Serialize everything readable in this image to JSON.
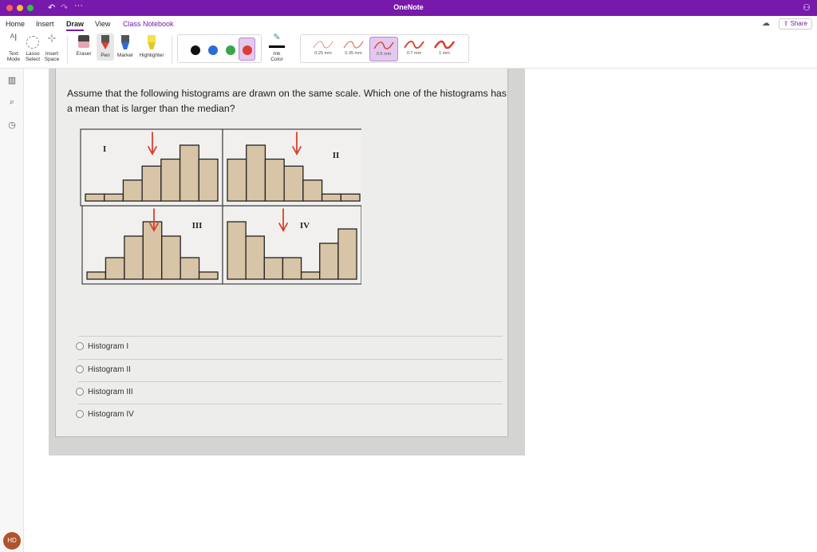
{
  "window": {
    "title": "OneNote"
  },
  "tabs": [
    "Home",
    "Insert",
    "Draw",
    "View",
    "Class Notebook"
  ],
  "active_tab": "Draw",
  "share_label": "Share",
  "ribbon": {
    "text_mode": "Text\nMode",
    "lasso": "Lasso\nSelect",
    "insert_space": "Insert\nSpace",
    "eraser": "Eraser",
    "pen": "Pen",
    "marker": "Marker",
    "highlighter": "Highlighter",
    "ink_color": "Ink\nColor",
    "colors": [
      "#111111",
      "#2f6ad9",
      "#3aa54a",
      "#e03b32"
    ],
    "selected_color": "#e03b32",
    "thicknesses": [
      "0.25 mm",
      "0.35 mm",
      "0.5 mm",
      "0.7 mm",
      "1 mm"
    ],
    "selected_thickness": "0.5 mm"
  },
  "user_initials": "HD",
  "question": "Assume that the following histograms are drawn on the same scale. Which one of the histograms has a mean that is larger than the median?",
  "histograms": [
    {
      "label": "I",
      "bars": [
        1,
        1,
        3,
        5,
        6,
        8,
        6
      ]
    },
    {
      "label": "II",
      "bars": [
        6,
        8,
        6,
        5,
        3,
        1,
        1
      ]
    },
    {
      "label": "III",
      "bars": [
        1,
        3,
        6,
        8,
        6,
        3,
        1
      ]
    },
    {
      "label": "IV",
      "bars": [
        8,
        6,
        3,
        3,
        1,
        5,
        7
      ]
    }
  ],
  "choices": [
    "Histogram I",
    "Histogram II",
    "Histogram III",
    "Histogram IV"
  ],
  "ink_color": "#d9402f"
}
